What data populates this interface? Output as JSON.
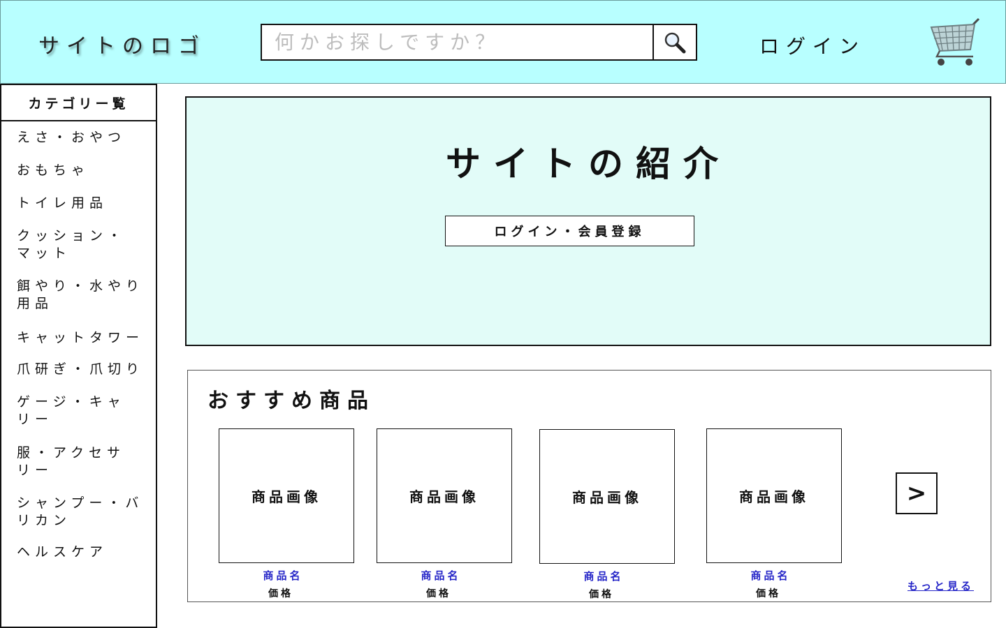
{
  "header": {
    "logo": "サイトのロゴ",
    "search_placeholder": "何かお探しですか？",
    "login": "ログイン",
    "cart_icon": "shopping-cart-icon",
    "search_icon": "magnifier-icon"
  },
  "sidebar": {
    "title": "カテゴリー覧",
    "items": [
      {
        "label": "えさ・おやつ"
      },
      {
        "label": "おもちゃ"
      },
      {
        "label": "トイレ用品"
      },
      {
        "label": "クッション・マット"
      },
      {
        "label": "餌やり・水やり用品"
      },
      {
        "label": "キャットタワー"
      },
      {
        "label": "爪研ぎ・爪切り"
      },
      {
        "label": "ゲージ・キャリー"
      },
      {
        "label": "服・アクセサリー"
      },
      {
        "label": "シャンプー・バリカン"
      },
      {
        "label": "ヘルスケア"
      }
    ]
  },
  "intro": {
    "title": "サイトの紹介",
    "button": "ログイン・会員登録"
  },
  "recommend": {
    "title": "おすすめ商品",
    "products": [
      {
        "image_label": "商品画像",
        "name": "商品名",
        "price": "価格"
      },
      {
        "image_label": "商品画像",
        "name": "商品名",
        "price": "価格"
      },
      {
        "image_label": "商品画像",
        "name": "商品名",
        "price": "価格"
      },
      {
        "image_label": "商品画像",
        "name": "商品名",
        "price": "価格"
      }
    ],
    "next": ">",
    "more": "もっと見る"
  },
  "colors": {
    "header_bg": "#b8ffff",
    "intro_bg": "#e2fcf8",
    "link": "#2626c8"
  }
}
